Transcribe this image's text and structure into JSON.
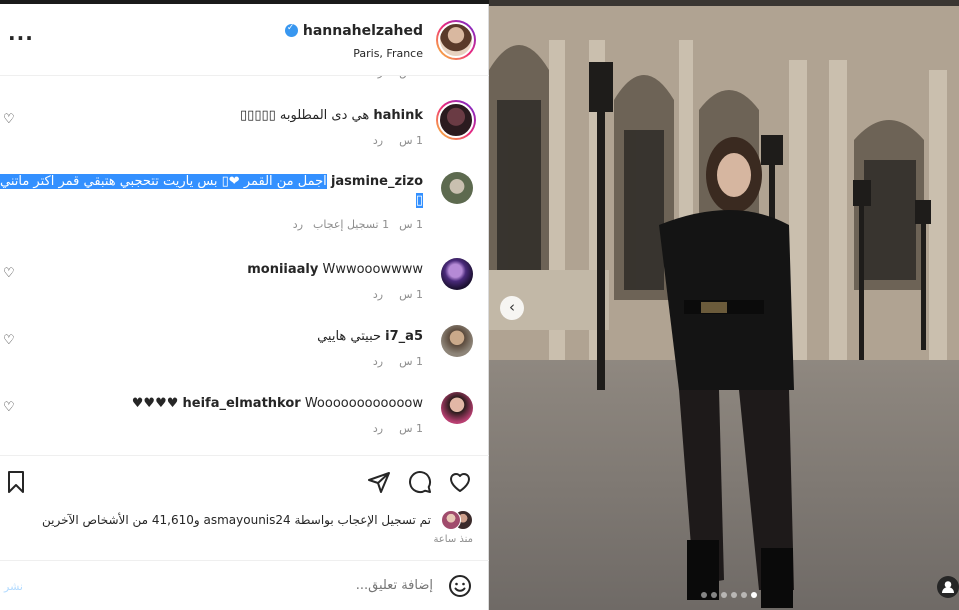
{
  "header": {
    "more": "···",
    "username": "hannahelzahed",
    "location": "Paris, France"
  },
  "comments": [
    {
      "username": "hahink",
      "text": "هي دى المطلوبه ▯▯▯▯▯",
      "time": "1 س",
      "reply": "رد",
      "liked": false
    },
    {
      "username": "jasmine_zizo",
      "text_line1": "اجمل من القمر ❤▯ بس ياريت تتحجبي هتبقي قمر اكتر ماتني❤▯",
      "text_line2": "▯",
      "time": "1 س",
      "likes": "1 تسجيل إعجاب",
      "reply": "رد",
      "liked": true
    },
    {
      "username": "moniiaaly",
      "text": "Wwwooowwww",
      "time": "1 س",
      "reply": "رد",
      "liked": false
    },
    {
      "username": "i7_a5",
      "text": "حبيتي هاييي",
      "time": "1 س",
      "reply": "رد",
      "liked": false
    },
    {
      "username": "heifa_elmathkor",
      "text": "Woooooooooooow ♥♥♥♥",
      "time": "1 س",
      "reply": "رد",
      "liked": false
    }
  ],
  "likes": {
    "text": "تم تسجيل الإعجاب بواسطة asmayounis24 و41,610 من الأشخاص الآخرين",
    "since": "منذ ساعة"
  },
  "add_comment": {
    "placeholder": "إضافة تعليق...",
    "post": "نشر"
  },
  "carousel": {
    "slides": 6,
    "active_index": 5
  }
}
